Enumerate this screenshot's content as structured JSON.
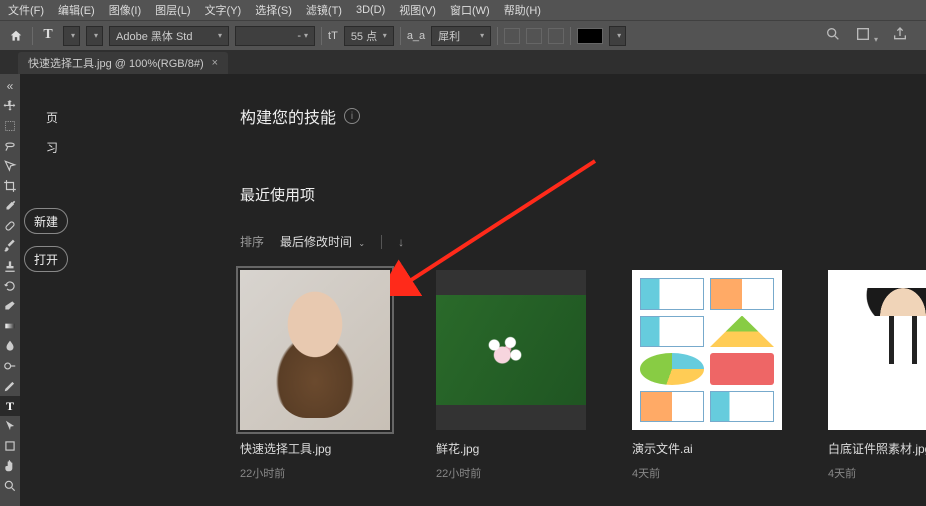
{
  "menu": {
    "file": "文件(F)",
    "edit": "编辑(E)",
    "image": "图像(I)",
    "layer": "图层(L)",
    "text": "文字(Y)",
    "select": "选择(S)",
    "filter": "滤镜(T)",
    "threeD": "3D(D)",
    "view": "视图(V)",
    "window": "窗口(W)",
    "help": "帮助(H)"
  },
  "optbar": {
    "toolGlyph": "T",
    "fontFamily": "Adobe 黑体 Std",
    "fontStyle": "-",
    "ttLabel": "tT",
    "fontSize": "55 点",
    "aa": "a_a",
    "sharp": "犀利"
  },
  "tab": {
    "title": "快速选择工具.jpg @ 100%(RGB/8#)"
  },
  "leftnav": {
    "home": "页",
    "learn": "习",
    "new": "新建",
    "open": "打开"
  },
  "main": {
    "headline": "构建您的技能",
    "recent": "最近使用项",
    "sortLabel": "排序",
    "sortValue": "最后修改时间"
  },
  "files": [
    {
      "name": "快速选择工具.jpg",
      "time": "22小时前"
    },
    {
      "name": "鲜花.jpg",
      "time": "22小时前"
    },
    {
      "name": "演示文件.ai",
      "time": "4天前"
    },
    {
      "name": "白底证件照素材.jpg",
      "time": "4天前"
    }
  ]
}
